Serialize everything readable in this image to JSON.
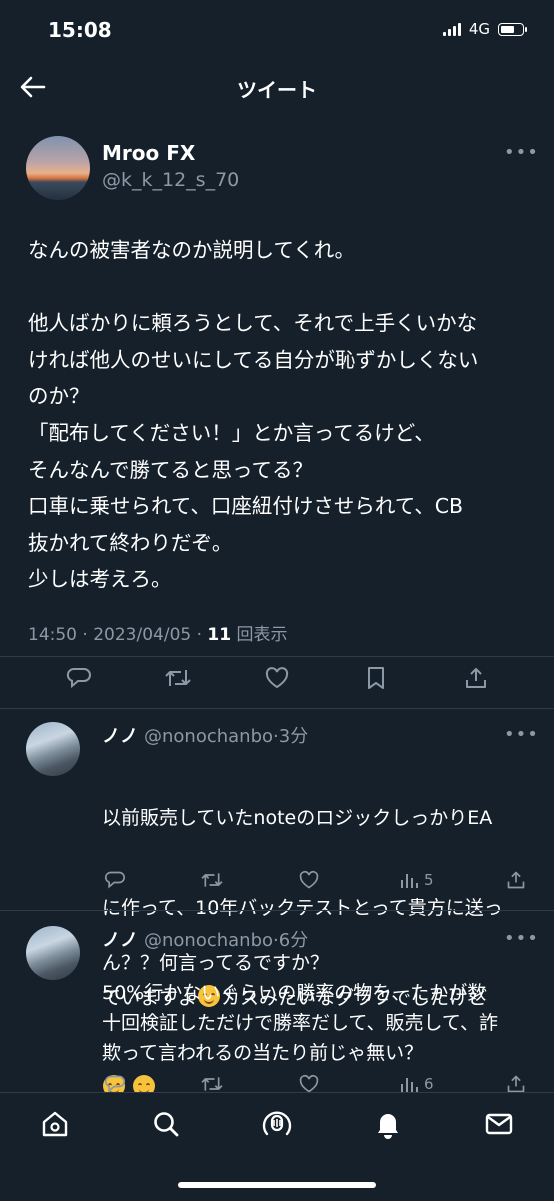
{
  "status_bar": {
    "time": "15:08",
    "network": "4G"
  },
  "header": {
    "title": "ツイート"
  },
  "tweet": {
    "author_name": "Mroo FX",
    "author_handle": "@k_k_12_s_70",
    "text": "なんの被害者なのか説明してくれ。\n\n他人ばかりに頼ろうとして、それで上手くいかな\nければ他人のせいにしてる自分が恥ずかしくない\nのか？\n「配布してください！」とか言ってるけど、\nそんなんで勝てると思ってる？\n口車に乗せられて、口座紐付けさせられて、CB\n抜かれて終わりだぞ。\n少しは考えろ。",
    "time": "14:50",
    "date": "2023/04/05",
    "views_count": "11",
    "views_label": "回表示"
  },
  "replies": [
    {
      "name": "ノノ",
      "handle": "@nonochanbo",
      "time_ago": "3分",
      "text_line1": "以前販売していたnoteのロジックしっかりEA",
      "text_line2": "に作って、10年バックテストとって貴方に送っ",
      "text_line3a": "ていますよ",
      "text_line3b": "カスみたいなグラフでしたけど",
      "views": "5"
    },
    {
      "name": "ノノ",
      "handle": "@nonochanbo",
      "time_ago": "6分",
      "text": "ん？？何言ってるですか？\n50%行かないぐらいの勝率の物を、たかが数\n十回検証しただけで勝率だして、販売して、詐\n欺って言われるの当たり前じゃ無い？",
      "views": "6"
    }
  ],
  "colors": {
    "background": "#15202b",
    "secondary_text": "#8b98a5",
    "divider": "#2f3b47"
  },
  "icons": {
    "tweet_actions": [
      "reply-icon",
      "retweet-icon",
      "like-icon",
      "bookmark-icon",
      "share-icon"
    ],
    "tab_bar": [
      "home-icon",
      "search-icon",
      "spaces-icon",
      "notifications-icon",
      "messages-icon"
    ]
  }
}
